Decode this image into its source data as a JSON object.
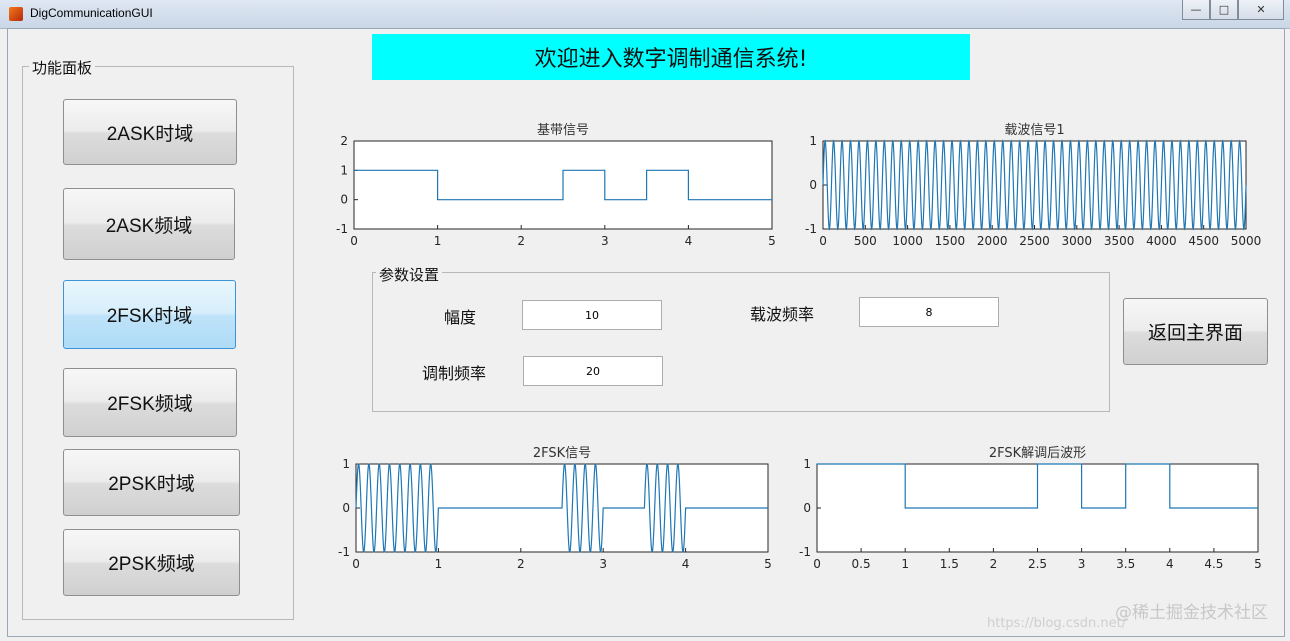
{
  "window": {
    "title": "DigCommunicationGUI",
    "controls": [
      "—",
      "□",
      "✕"
    ]
  },
  "banner": "欢迎进入数字调制通信系统!",
  "function_panel": {
    "title": "功能面板",
    "buttons": [
      "2ASK时域",
      "2ASK频域",
      "2FSK时域",
      "2FSK频域",
      "2PSK时域",
      "2PSK频域"
    ],
    "active_index": 2
  },
  "params": {
    "title": "参数设置",
    "amplitude_label": "幅度",
    "amplitude_value": "10",
    "carrier_label": "载波频率",
    "carrier_value": "8",
    "modfreq_label": "调制频率",
    "modfreq_value": "20"
  },
  "back_button": "返回主界面",
  "watermark": "@稀土掘金技术社区",
  "watermark_url": "https://blog.csdn.net/",
  "colors": {
    "line": "#1f77b4",
    "banner": "#00ffff",
    "active": "#bfe3f9"
  },
  "chart_data": [
    {
      "type": "line",
      "title": "基带信号",
      "x": [
        0,
        1,
        1,
        2.5,
        2.5,
        3,
        3,
        3.5,
        3.5,
        4,
        4,
        5
      ],
      "y": [
        1,
        1,
        0,
        0,
        1,
        1,
        0,
        0,
        1,
        1,
        0,
        0
      ],
      "xlim": [
        0,
        5
      ],
      "ylim": [
        -1,
        2
      ],
      "xticks": [
        0,
        1,
        2,
        3,
        4,
        5
      ],
      "yticks": [
        -1,
        0,
        1,
        2
      ]
    },
    {
      "type": "line",
      "title": "载波信号1",
      "kind": "sine",
      "cycles": 50,
      "xlim": [
        0,
        5000
      ],
      "ylim": [
        -1,
        1
      ],
      "xticks": [
        0,
        500,
        1000,
        1500,
        2000,
        2500,
        3000,
        3500,
        4000,
        4500,
        5000
      ],
      "yticks": [
        -1,
        0,
        1
      ]
    },
    {
      "type": "line",
      "title": "2FSK信号",
      "kind": "fsk",
      "bits": [
        [
          0,
          1,
          1
        ],
        [
          1,
          2.5,
          0
        ],
        [
          2.5,
          3,
          1
        ],
        [
          3,
          3.5,
          0
        ],
        [
          3.5,
          4,
          1
        ],
        [
          4,
          5,
          0
        ]
      ],
      "cycles_per_unit": 8,
      "xlim": [
        0,
        5
      ],
      "ylim": [
        -1,
        1
      ],
      "xticks": [
        0,
        1,
        2,
        3,
        4,
        5
      ],
      "yticks": [
        -1,
        0,
        1
      ]
    },
    {
      "type": "line",
      "title": "2FSK解调后波形",
      "x": [
        0,
        1,
        1,
        2.5,
        2.5,
        3,
        3,
        3.5,
        3.5,
        4,
        4,
        5
      ],
      "y": [
        1,
        1,
        0,
        0,
        1,
        1,
        0,
        0,
        1,
        1,
        0,
        0
      ],
      "xlim": [
        0,
        5
      ],
      "ylim": [
        -1,
        1
      ],
      "xticks": [
        0,
        0.5,
        1,
        1.5,
        2,
        2.5,
        3,
        3.5,
        4,
        4.5,
        5
      ],
      "yticks": [
        -1,
        0,
        1
      ]
    }
  ]
}
